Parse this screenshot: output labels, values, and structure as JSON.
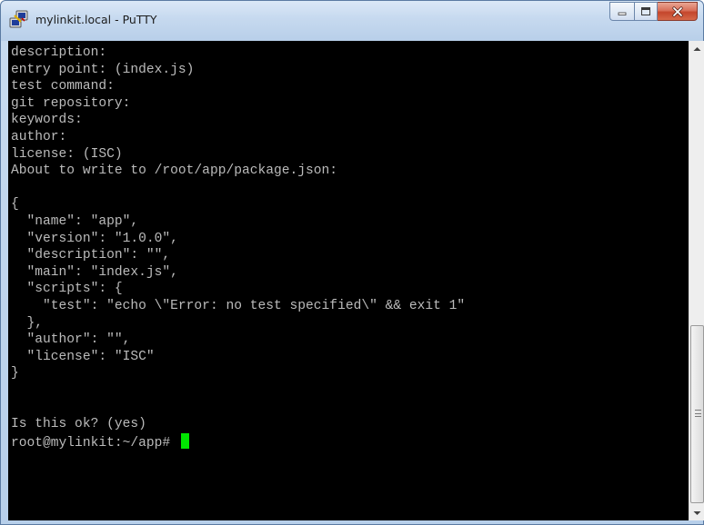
{
  "window": {
    "title": "mylinkit.local - PuTTY",
    "controls": [
      "minimize",
      "maximize",
      "close"
    ]
  },
  "terminal": {
    "lines": [
      "description:",
      "entry point: (index.js)",
      "test command:",
      "git repository:",
      "keywords:",
      "author:",
      "license: (ISC)",
      "About to write to /root/app/package.json:",
      "",
      "{",
      "  \"name\": \"app\",",
      "  \"version\": \"1.0.0\",",
      "  \"description\": \"\",",
      "  \"main\": \"index.js\",",
      "  \"scripts\": {",
      "    \"test\": \"echo \\\"Error: no test specified\\\" && exit 1\"",
      "  },",
      "  \"author\": \"\",",
      "  \"license\": \"ISC\"",
      "}",
      "",
      "",
      "Is this ok? (yes)"
    ],
    "prompt": "root@mylinkit:~/app# ",
    "cursor_color": "#00e600",
    "text_color": "#bbbbbb",
    "background": "#000000"
  },
  "icons": {
    "app": "putty-icon",
    "minimize": "minimize-icon",
    "maximize": "maximize-icon",
    "close": "close-icon",
    "scroll_up": "scroll-up-arrow-icon",
    "scroll_down": "scroll-down-arrow-icon"
  }
}
